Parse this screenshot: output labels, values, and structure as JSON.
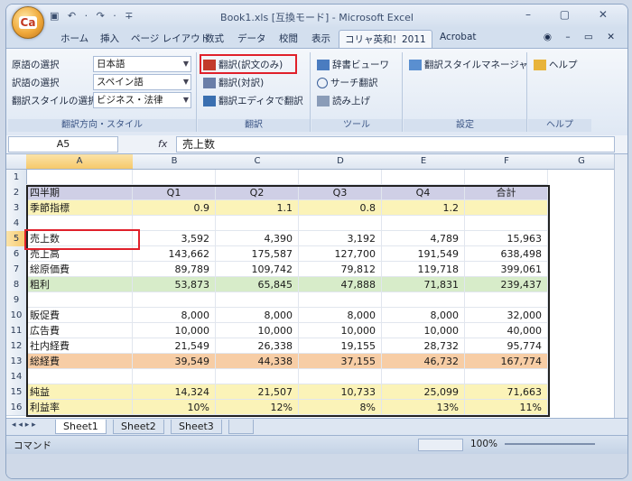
{
  "app": {
    "title": "Book1.xls [互換モード] - Microsoft Excel",
    "office_button_label": "Ca",
    "qat_text": "▣ ↶ · ↷ · ∓",
    "window_controls": "– ▢ ✕"
  },
  "tabs": [
    "ホーム",
    "挿入",
    "ページ レイアウト",
    "数式",
    "データ",
    "校閲",
    "表示",
    "コリャ英和！2011",
    "Acrobat"
  ],
  "tabs_right": "◉ – ▭ ✕",
  "ribbon": {
    "group1": {
      "rows": [
        "原語の選択",
        "訳語の選択",
        "翻訳スタイルの選択"
      ],
      "combos": [
        "日本語",
        "スペイン語",
        "ビジネス・法律"
      ],
      "label": "翻訳方向・スタイル"
    },
    "group2": {
      "rows": [
        "翻訳(訳文のみ)",
        "翻訳(対訳)",
        "翻訳エディタで翻訳"
      ],
      "label": "翻訳"
    },
    "group3": {
      "rows": [
        "辞書ビューワ",
        "サーチ翻訳",
        "読み上げ"
      ],
      "label": "ツール"
    },
    "group4": {
      "rows": [
        "翻訳スタイルマネージャ"
      ],
      "label": "設定"
    },
    "group5": {
      "rows": [
        "ヘルプ"
      ],
      "label": "ヘルプ"
    }
  },
  "formula_bar": {
    "name_box": "A5",
    "fx": "fx",
    "value": "売上数"
  },
  "columns": [
    "A",
    "B",
    "C",
    "D",
    "E",
    "F",
    "G"
  ],
  "rows": [
    {
      "n": "1",
      "cells": [
        "",
        "",
        "",
        "",
        "",
        ""
      ]
    },
    {
      "n": "2",
      "cells": [
        "四半期",
        "Q1",
        "Q2",
        "Q3",
        "Q4",
        "合計"
      ]
    },
    {
      "n": "3",
      "cells": [
        "季節指標",
        "0.9",
        "1.1",
        "0.8",
        "1.2",
        ""
      ]
    },
    {
      "n": "4",
      "cells": [
        "",
        "",
        "",
        "",
        "",
        ""
      ]
    },
    {
      "n": "5",
      "cells": [
        "売上数",
        "3,592",
        "4,390",
        "3,192",
        "4,789",
        "15,963"
      ]
    },
    {
      "n": "6",
      "cells": [
        "売上高",
        "143,662",
        "175,587",
        "127,700",
        "191,549",
        "638,498"
      ]
    },
    {
      "n": "7",
      "cells": [
        "総原価費",
        "89,789",
        "109,742",
        "79,812",
        "119,718",
        "399,061"
      ]
    },
    {
      "n": "8",
      "cells": [
        "粗利",
        "53,873",
        "65,845",
        "47,888",
        "71,831",
        "239,437"
      ]
    },
    {
      "n": "9",
      "cells": [
        "",
        "",
        "",
        "",
        "",
        ""
      ]
    },
    {
      "n": "10",
      "cells": [
        "販促費",
        "8,000",
        "8,000",
        "8,000",
        "8,000",
        "32,000"
      ]
    },
    {
      "n": "11",
      "cells": [
        "広告費",
        "10,000",
        "10,000",
        "10,000",
        "10,000",
        "40,000"
      ]
    },
    {
      "n": "12",
      "cells": [
        "社内経費",
        "21,549",
        "26,338",
        "19,155",
        "28,732",
        "95,774"
      ]
    },
    {
      "n": "13",
      "cells": [
        "総経費",
        "39,549",
        "44,338",
        "37,155",
        "46,732",
        "167,774"
      ]
    },
    {
      "n": "14",
      "cells": [
        "",
        "",
        "",
        "",
        "",
        ""
      ]
    },
    {
      "n": "15",
      "cells": [
        "純益",
        "14,324",
        "21,507",
        "10,733",
        "25,099",
        "71,663"
      ]
    },
    {
      "n": "16",
      "cells": [
        "利益率",
        "10%",
        "12%",
        "8%",
        "13%",
        "11%"
      ]
    }
  ],
  "row_colors": {
    "2": "#cfcfe6",
    "3": "#fbf3b8",
    "8": "#d7ecc9",
    "13": "#f7cda5",
    "15": "#fbf3b8",
    "16": "#fbf3b8"
  },
  "sheets": [
    "Sheet1",
    "Sheet2",
    "Sheet3"
  ],
  "sheet_nav": "◂ ◂ ▸ ▸",
  "status": {
    "mode": "コマンド",
    "zoom": "100%"
  }
}
